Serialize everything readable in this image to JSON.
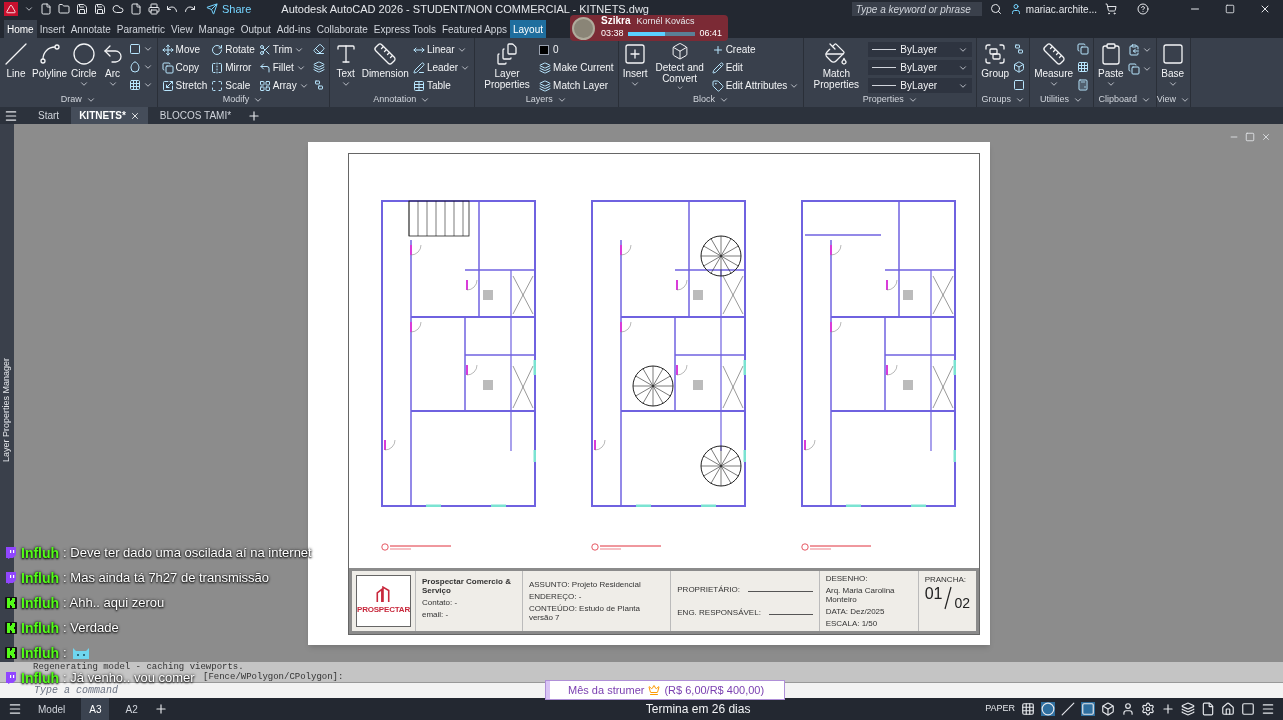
{
  "title_bar": {
    "title": "Autodesk AutoCAD 2026 - STUDENT/NON COMMERCIAL - KITNETS.dwg",
    "share": "Share",
    "search": {
      "placeholder": "Type a keyword or phrase"
    },
    "user": "mariac.archite..."
  },
  "ribbon_tabs": [
    {
      "label": "Home",
      "selected": true,
      "kind": "normal"
    },
    {
      "label": "Insert",
      "selected": false,
      "kind": "normal"
    },
    {
      "label": "Annotate",
      "selected": false,
      "kind": "normal"
    },
    {
      "label": "Parametric",
      "selected": false,
      "kind": "normal"
    },
    {
      "label": "View",
      "selected": false,
      "kind": "normal"
    },
    {
      "label": "Manage",
      "selected": false,
      "kind": "normal"
    },
    {
      "label": "Output",
      "selected": false,
      "kind": "normal"
    },
    {
      "label": "Add-ins",
      "selected": false,
      "kind": "normal"
    },
    {
      "label": "Collaborate",
      "selected": false,
      "kind": "normal"
    },
    {
      "label": "Express Tools",
      "selected": false,
      "kind": "normal"
    },
    {
      "label": "Featured Apps",
      "selected": false,
      "kind": "normal"
    },
    {
      "label": "Layout",
      "selected": false,
      "kind": "contextual"
    }
  ],
  "ribbon_panels": [
    {
      "title": "Draw",
      "tools": [
        {
          "kind": "large",
          "label": "Line",
          "dropdown": false
        },
        {
          "kind": "large",
          "label": "Polyline",
          "dropdown": false
        },
        {
          "kind": "large",
          "label": "Circle",
          "dropdown": true
        },
        {
          "kind": "large",
          "label": "Arc",
          "dropdown": true
        },
        {
          "kind": "icon",
          "dropdown": true
        },
        {
          "kind": "icon",
          "dropdown": true
        },
        {
          "kind": "icon",
          "dropdown": true
        }
      ]
    },
    {
      "title": "Modify",
      "tools": [
        {
          "kind": "small",
          "label": "Move",
          "dropdown": false
        },
        {
          "kind": "small",
          "label": "Copy",
          "dropdown": false
        },
        {
          "kind": "small",
          "label": "Stretch",
          "dropdown": false
        },
        {
          "kind": "small",
          "label": "Rotate",
          "dropdown": false
        },
        {
          "kind": "small",
          "label": "Mirror",
          "dropdown": false
        },
        {
          "kind": "small",
          "label": "Scale",
          "dropdown": false
        },
        {
          "kind": "small",
          "label": "Trim",
          "dropdown": true
        },
        {
          "kind": "small",
          "label": "Fillet",
          "dropdown": true
        },
        {
          "kind": "small",
          "label": "Array",
          "dropdown": true
        },
        {
          "kind": "icon",
          "dropdown": false
        },
        {
          "kind": "icon",
          "dropdown": false
        },
        {
          "kind": "icon",
          "dropdown": false
        }
      ]
    },
    {
      "title": "Annotation",
      "tools": [
        {
          "kind": "large",
          "label": "Text",
          "dropdown": true
        },
        {
          "kind": "large",
          "label": "Dimension",
          "dropdown": false
        },
        {
          "kind": "small",
          "label": "Linear",
          "dropdown": true
        },
        {
          "kind": "small",
          "label": "Leader",
          "dropdown": true
        },
        {
          "kind": "small",
          "label": "Table",
          "dropdown": false
        }
      ]
    },
    {
      "title": "Layers",
      "tools": [
        {
          "kind": "large",
          "label": "Layer Properties",
          "dropdown": false
        },
        {
          "kind": "layer",
          "label": "0"
        },
        {
          "kind": "small",
          "label": "Make Current",
          "dropdown": false
        },
        {
          "kind": "small",
          "label": "Match Layer",
          "dropdown": false
        }
      ]
    },
    {
      "title": "Block",
      "tools": [
        {
          "kind": "large",
          "label": "Insert",
          "dropdown": true
        },
        {
          "kind": "large",
          "label": "Detect and Convert",
          "dropdown": true
        },
        {
          "kind": "small",
          "label": "Create",
          "dropdown": false
        },
        {
          "kind": "small",
          "label": "Edit",
          "dropdown": false
        },
        {
          "kind": "small",
          "label": "Edit Attributes",
          "dropdown": true
        }
      ]
    },
    {
      "title": "Properties",
      "tools": [
        {
          "kind": "large",
          "label": "Match Properties",
          "dropdown": false
        },
        {
          "kind": "combo",
          "label": "ByLayer",
          "dropdown": true
        },
        {
          "kind": "combo",
          "label": "ByLayer",
          "dropdown": true
        },
        {
          "kind": "combo",
          "label": "ByLayer",
          "dropdown": true
        }
      ]
    },
    {
      "title": "Groups",
      "tools": [
        {
          "kind": "large",
          "label": "Group",
          "dropdown": false
        },
        {
          "kind": "icon",
          "dropdown": false
        },
        {
          "kind": "icon",
          "dropdown": false
        },
        {
          "kind": "icon",
          "dropdown": false
        }
      ]
    },
    {
      "title": "Utilities",
      "tools": [
        {
          "kind": "large",
          "label": "Measure",
          "dropdown": true
        },
        {
          "kind": "icon",
          "dropdown": false
        },
        {
          "kind": "icon",
          "dropdown": false
        },
        {
          "kind": "icon",
          "dropdown": false
        }
      ]
    },
    {
      "title": "Clipboard",
      "tools": [
        {
          "kind": "large",
          "label": "Paste",
          "dropdown": true
        },
        {
          "kind": "icon",
          "dropdown": true
        },
        {
          "kind": "icon",
          "dropdown": true
        }
      ]
    },
    {
      "title": "View",
      "tools": [
        {
          "kind": "large",
          "label": "Base",
          "dropdown": true
        }
      ]
    }
  ],
  "document_tabs": [
    {
      "label": "Start",
      "selected": false,
      "closable": false
    },
    {
      "label": "KITNETS*",
      "selected": true,
      "closable": true
    },
    {
      "label": "BLOCOS TAMI*",
      "selected": false,
      "closable": false
    }
  ],
  "side_palette": {
    "title": "Layer Properties Manager"
  },
  "sheet": {
    "plans": [
      {
        "kind": "stair"
      },
      {
        "kind": "spiral"
      },
      {
        "kind": "plain"
      }
    ],
    "title_block": {
      "logo": "PROSPECTAR",
      "company": "Prospectar Comercio & Serviço",
      "contact": "Contato: -",
      "email": "email: -",
      "subject": "ASSUNTO: Projeto Residencial",
      "address": "ENDEREÇO: -",
      "content": "CONTEÚDO: Estudo de Planta versão 7",
      "owner": "PROPRIETÁRIO:",
      "engineer": "ENG. RESPONSÁVEL:",
      "drawing_label": "DESENHO:",
      "drawing_by": "Arq. Maria Carolina Monteiro",
      "date": "DATA: Dez/2025",
      "scale": "ESCALA: 1/50",
      "sheet_label": "PRANCHA:",
      "sheet_number": "01",
      "sheet_total": "02"
    }
  },
  "command_line": {
    "history": [
      "Regenerating model - caching viewports.",
      "[Fence/WPolygon/CPolygon]:"
    ],
    "placeholder": "Type a command"
  },
  "layout_tabs": [
    {
      "label": "Model",
      "selected": false
    },
    {
      "label": "A3",
      "selected": true
    },
    {
      "label": "A2",
      "selected": false
    }
  ],
  "status_bar": {
    "space": "PAPER"
  },
  "music_overlay": {
    "title": "Szikra",
    "artist": "Kornél Kovács",
    "elapsed": "03:38",
    "duration": "06:41",
    "level": 0.55
  },
  "chat": [
    {
      "kind": "twitch",
      "user": "Influh",
      "emote": false,
      "message": ": Deve ter dado uma oscilada aí na internet"
    },
    {
      "kind": "twitch",
      "user": "Influh",
      "emote": false,
      "message": ": Mas ainda tá 7h27 de transmissão"
    },
    {
      "kind": "kick",
      "user": "Influh",
      "emote": false,
      "message": ": Ahh.. aqui zerou"
    },
    {
      "kind": "kick",
      "user": "Influh",
      "emote": false,
      "message": ": Verdade"
    },
    {
      "kind": "kick",
      "user": "Influh",
      "emote": true,
      "message": ":"
    },
    {
      "kind": "twitch",
      "user": "Influh",
      "emote": false,
      "message": ": Já venho.. vou comer"
    }
  ],
  "goal_overlay": {
    "label": "Mês da strumer",
    "amount": "(R$ 6,00/R$ 400,00)",
    "level": 0.015,
    "ends": "Termina em 26 dias"
  }
}
